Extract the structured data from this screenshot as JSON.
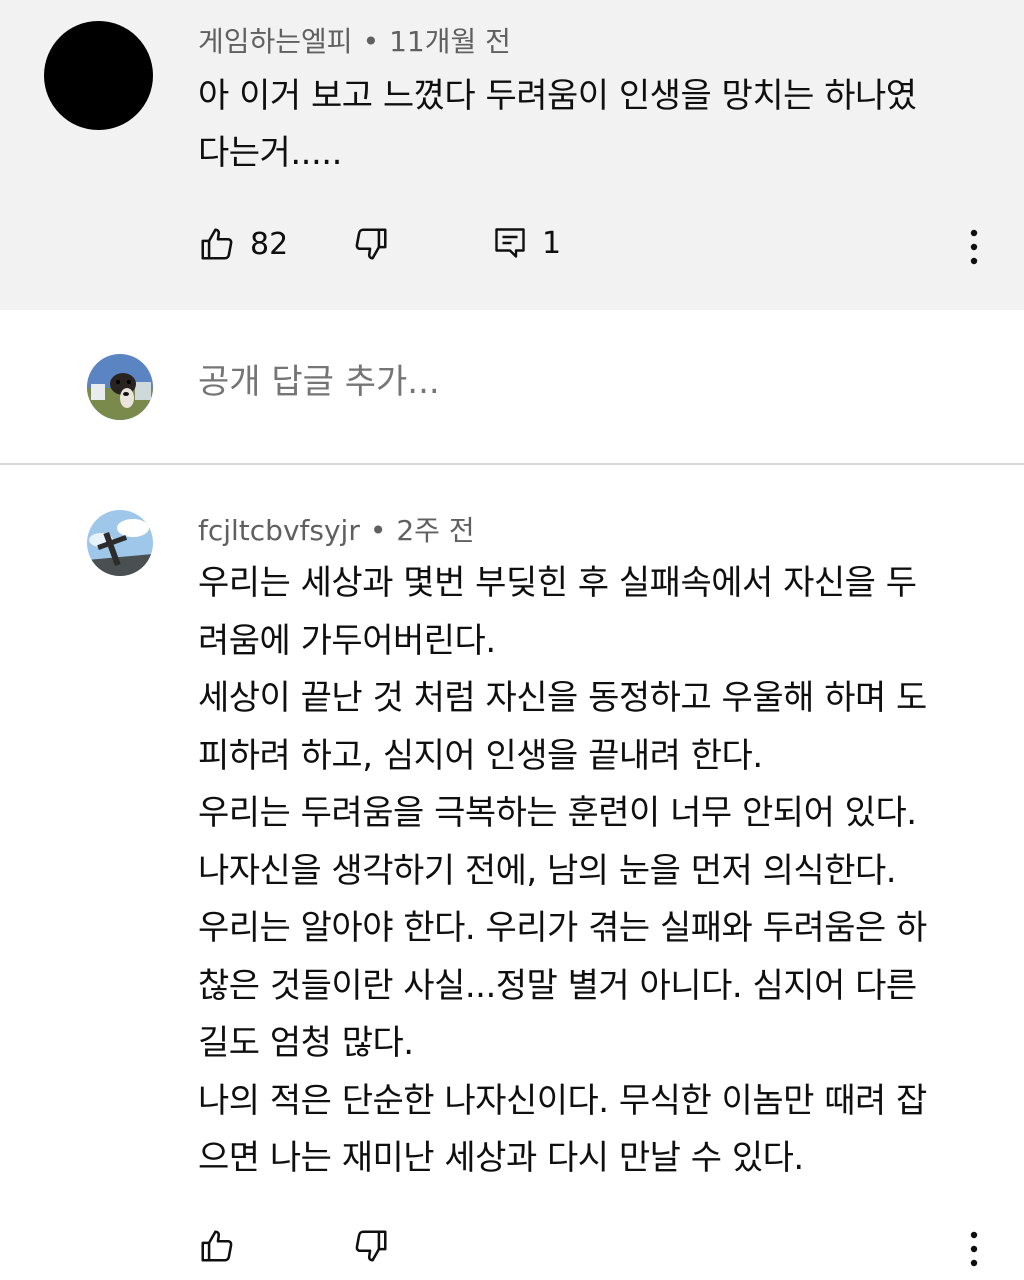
{
  "top_comment": {
    "author": "게임하는엘피",
    "separator": "•",
    "time": "11개월 전",
    "text": "아 이거 보고 느꼈다 두려움이 인생을 망치는 하나였\n다는거.....",
    "like_count": "82",
    "reply_count": "1"
  },
  "reply_box": {
    "placeholder": "공개 답글 추가..."
  },
  "reply_comment": {
    "author": "fcjltcbvfsyjr",
    "separator": "•",
    "time": "2주 전",
    "text": "우리는 세상과 몇번 부딪힌 후 실패속에서 자신을 두\n려움에 가두어버린다.\n세상이 끝난 것 처럼 자신을 동정하고 우울해 하며 도\n피하려 하고, 심지어 인생을 끝내려 한다.\n우리는 두려움을 극복하는 훈련이 너무 안되어 있다.\n나자신을 생각하기 전에, 남의 눈을 먼저 의식한다.\n우리는 알아야 한다. 우리가 겪는 실패와 두려움은 하\n찮은 것들이란 사실...정말 별거 아니다. 심지어 다른\n길도 엄청 많다.\n나의 적은 단순한 나자신이다. 무식한 이놈만 때려 잡\n으면 나는 재미난 세상과 다시 만날 수 있다."
  },
  "icons": {
    "like": "thumbs-up-icon",
    "dislike": "thumbs-down-icon",
    "reply": "comment-icon",
    "more": "more-vert-icon"
  },
  "colors": {
    "highlight_bg": "#f2f2f2",
    "meta_text": "#606060",
    "body_text": "#0f0f0f"
  }
}
